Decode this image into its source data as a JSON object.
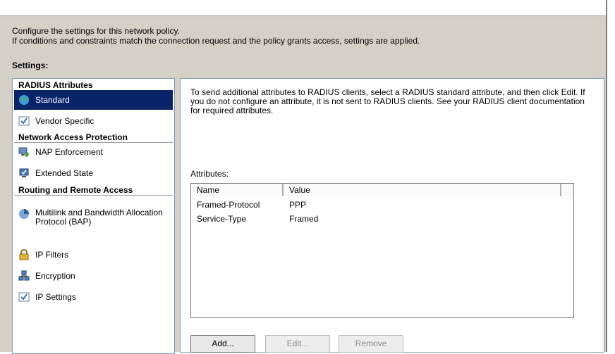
{
  "intro": {
    "line1": "Configure the settings for this network policy.",
    "line2": "If conditions and constraints match the connection request and the policy grants access, settings are applied."
  },
  "settings_label": "Settings:",
  "nav": {
    "sections": [
      {
        "title": "RADIUS Attributes"
      },
      {
        "title": "Network Access Protection"
      },
      {
        "title": "Routing and Remote Access"
      }
    ],
    "items": [
      {
        "label": "Standard",
        "icon": "globe-icon"
      },
      {
        "label": "Vendor Specific",
        "icon": "checkbox-icon"
      },
      {
        "label": "NAP Enforcement",
        "icon": "computer-shield-icon"
      },
      {
        "label": "Extended State",
        "icon": "computer-check-icon"
      },
      {
        "label": "Multilink and Bandwidth Allocation Protocol (BAP)",
        "icon": "pie-chart-icon"
      },
      {
        "label": "IP Filters",
        "icon": "lock-icon"
      },
      {
        "label": "Encryption",
        "icon": "network-computers-icon"
      },
      {
        "label": "IP Settings",
        "icon": "checkbox-icon"
      }
    ]
  },
  "content": {
    "description": "To send additional attributes to RADIUS clients, select a RADIUS standard attribute, and then click Edit. If you do not configure an attribute, it is not sent to RADIUS clients. See your RADIUS client documentation for required attributes.",
    "attributes_label": "Attributes:",
    "columns": [
      "Name",
      "Value"
    ],
    "rows": [
      {
        "name": "Framed-Protocol",
        "value": "PPP"
      },
      {
        "name": "Service-Type",
        "value": "Framed"
      }
    ],
    "buttons": {
      "add": "Add...",
      "edit": "Edit...",
      "remove": "Remove"
    }
  }
}
